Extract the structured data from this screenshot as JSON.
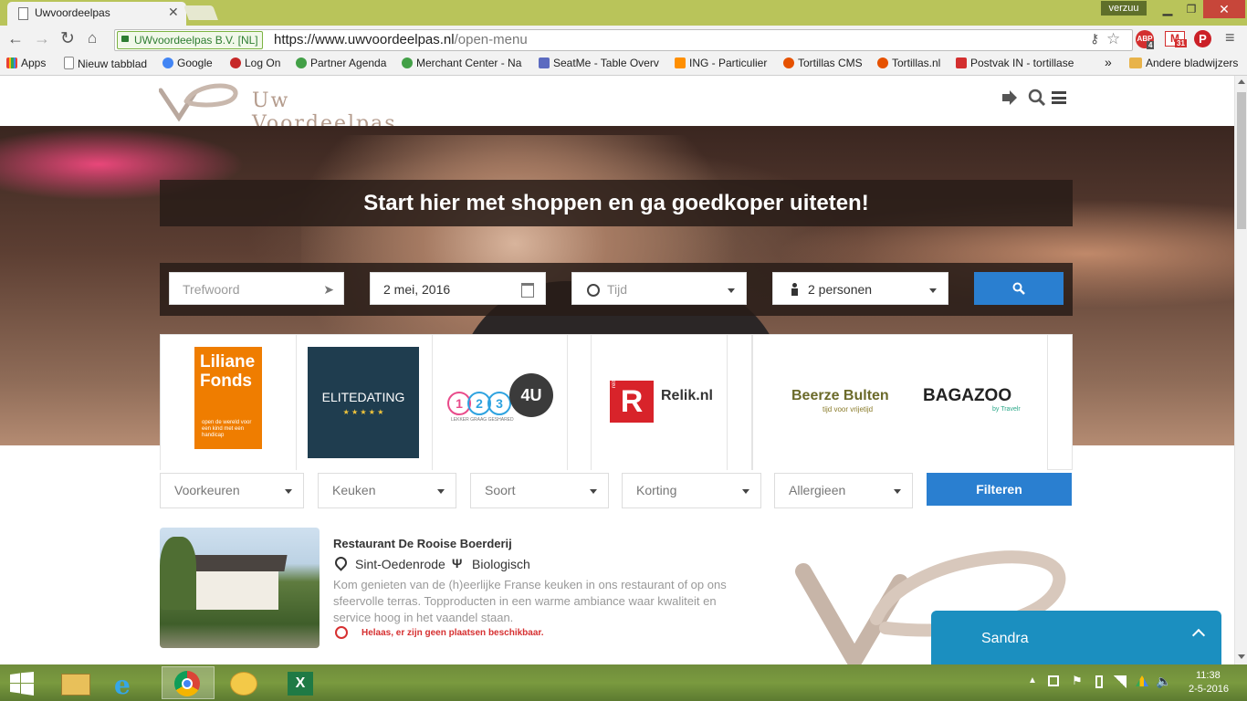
{
  "browser": {
    "tab_title": "Uwvoordeelpas",
    "window_label": "verzuu",
    "ssl_org": "UWvoordeelpas B.V. [NL]",
    "url_scheme_host": "https://www.uwvoordeelpas.nl",
    "url_path": "/open-menu",
    "ext_abp_badge": "4",
    "ext_gmail_badge": "31"
  },
  "bookmarks": [
    {
      "label": "Apps",
      "color": "#e94235"
    },
    {
      "label": "Nieuw tabblad",
      "color": "#9e9e9e"
    },
    {
      "label": "Google",
      "color": "#4285f4"
    },
    {
      "label": "Log On",
      "color": "#c62828"
    },
    {
      "label": "Partner Agenda",
      "color": "#43a047"
    },
    {
      "label": "Merchant Center - Na",
      "color": "#43a047"
    },
    {
      "label": "SeatMe - Table Overv",
      "color": "#5c6bc0"
    },
    {
      "label": "ING - Particulier",
      "color": "#ff8f00"
    },
    {
      "label": "Tortillas CMS",
      "color": "#e65100"
    },
    {
      "label": "Tortillas.nl",
      "color": "#e65100"
    },
    {
      "label": "Postvak IN - tortillase",
      "color": "#d32f2f"
    }
  ],
  "bookmarks_more": "»",
  "bookmarks_other": "Andere bladwijzers",
  "site": {
    "logo_text": "Uw Voordeelpas",
    "hero_title": "Start hier met shoppen en ga goedkoper uiteten!",
    "search": {
      "keyword_placeholder": "Trefwoord",
      "date_value": "2 mei, 2016",
      "time_placeholder": "Tijd",
      "persons_value": "2 personen"
    },
    "partners": [
      {
        "name": "Liliane Fonds",
        "line1": "Liliane",
        "line2": "Fonds",
        "tagline": "open de wereld voor een kind met een handicap"
      },
      {
        "name": "EliteDating",
        "text": "ELITEDATING",
        "stars": "★ ★ ★ ★ ★"
      },
      {
        "name": "1234U",
        "digits": [
          "1",
          "2",
          "3",
          "4U"
        ],
        "tagline": "LEKKER GRAAG GESHARED"
      },
      {
        "name": "Relik.nl",
        "brand": "reisburo",
        "text": "Relik.nl"
      },
      {
        "name": "Beerze Bulten",
        "text": "Beerze Bulten",
        "tagline": "tijd voor vrijetijd"
      },
      {
        "name": "Bagazoo",
        "text": "BAGAZOO",
        "tagline": "by Travelr"
      }
    ],
    "filters": [
      "Voorkeuren",
      "Keuken",
      "Soort",
      "Korting",
      "Allergieen"
    ],
    "filter_button": "Filteren",
    "restaurant": {
      "name": "Restaurant De Rooise Boerderij",
      "location": "Sint-Oedenrode",
      "kitchen": "Biologisch",
      "description": "Kom genieten van de (h)eerlijke Franse keuken in ons restaurant of op ons sfeervolle terras. Topproducten in een warme ambiance waar kwaliteit en service hoog in het vaandel staan.",
      "availability": "Helaas, er zijn geen plaatsen beschikbaar."
    },
    "chat": {
      "name": "Sandra",
      "color": "#1b8fc0"
    },
    "colors": {
      "accent_blue": "#2a7fd0",
      "unavailable_red": "#d63031"
    }
  },
  "taskbar": {
    "time": "11:38",
    "date": "2-5-2016"
  }
}
